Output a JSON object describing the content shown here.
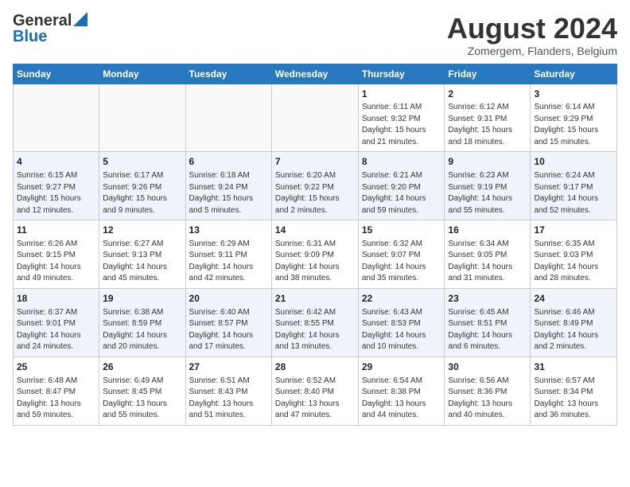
{
  "header": {
    "logo_general": "General",
    "logo_blue": "Blue",
    "month_title": "August 2024",
    "location": "Zomergem, Flanders, Belgium"
  },
  "weekdays": [
    "Sunday",
    "Monday",
    "Tuesday",
    "Wednesday",
    "Thursday",
    "Friday",
    "Saturday"
  ],
  "rows": [
    {
      "cells": [
        {
          "day": "",
          "empty": true
        },
        {
          "day": "",
          "empty": true
        },
        {
          "day": "",
          "empty": true
        },
        {
          "day": "",
          "empty": true
        },
        {
          "day": "1",
          "sunrise": "6:11 AM",
          "sunset": "9:32 PM",
          "daylight": "15 hours and 21 minutes."
        },
        {
          "day": "2",
          "sunrise": "6:12 AM",
          "sunset": "9:31 PM",
          "daylight": "15 hours and 18 minutes."
        },
        {
          "day": "3",
          "sunrise": "6:14 AM",
          "sunset": "9:29 PM",
          "daylight": "15 hours and 15 minutes."
        }
      ]
    },
    {
      "stripe": true,
      "cells": [
        {
          "day": "4",
          "sunrise": "6:15 AM",
          "sunset": "9:27 PM",
          "daylight": "15 hours and 12 minutes."
        },
        {
          "day": "5",
          "sunrise": "6:17 AM",
          "sunset": "9:26 PM",
          "daylight": "15 hours and 9 minutes."
        },
        {
          "day": "6",
          "sunrise": "6:18 AM",
          "sunset": "9:24 PM",
          "daylight": "15 hours and 5 minutes."
        },
        {
          "day": "7",
          "sunrise": "6:20 AM",
          "sunset": "9:22 PM",
          "daylight": "15 hours and 2 minutes."
        },
        {
          "day": "8",
          "sunrise": "6:21 AM",
          "sunset": "9:20 PM",
          "daylight": "14 hours and 59 minutes."
        },
        {
          "day": "9",
          "sunrise": "6:23 AM",
          "sunset": "9:19 PM",
          "daylight": "14 hours and 55 minutes."
        },
        {
          "day": "10",
          "sunrise": "6:24 AM",
          "sunset": "9:17 PM",
          "daylight": "14 hours and 52 minutes."
        }
      ]
    },
    {
      "cells": [
        {
          "day": "11",
          "sunrise": "6:26 AM",
          "sunset": "9:15 PM",
          "daylight": "14 hours and 49 minutes."
        },
        {
          "day": "12",
          "sunrise": "6:27 AM",
          "sunset": "9:13 PM",
          "daylight": "14 hours and 45 minutes."
        },
        {
          "day": "13",
          "sunrise": "6:29 AM",
          "sunset": "9:11 PM",
          "daylight": "14 hours and 42 minutes."
        },
        {
          "day": "14",
          "sunrise": "6:31 AM",
          "sunset": "9:09 PM",
          "daylight": "14 hours and 38 minutes."
        },
        {
          "day": "15",
          "sunrise": "6:32 AM",
          "sunset": "9:07 PM",
          "daylight": "14 hours and 35 minutes."
        },
        {
          "day": "16",
          "sunrise": "6:34 AM",
          "sunset": "9:05 PM",
          "daylight": "14 hours and 31 minutes."
        },
        {
          "day": "17",
          "sunrise": "6:35 AM",
          "sunset": "9:03 PM",
          "daylight": "14 hours and 28 minutes."
        }
      ]
    },
    {
      "stripe": true,
      "cells": [
        {
          "day": "18",
          "sunrise": "6:37 AM",
          "sunset": "9:01 PM",
          "daylight": "14 hours and 24 minutes."
        },
        {
          "day": "19",
          "sunrise": "6:38 AM",
          "sunset": "8:59 PM",
          "daylight": "14 hours and 20 minutes."
        },
        {
          "day": "20",
          "sunrise": "6:40 AM",
          "sunset": "8:57 PM",
          "daylight": "14 hours and 17 minutes."
        },
        {
          "day": "21",
          "sunrise": "6:42 AM",
          "sunset": "8:55 PM",
          "daylight": "14 hours and 13 minutes."
        },
        {
          "day": "22",
          "sunrise": "6:43 AM",
          "sunset": "8:53 PM",
          "daylight": "14 hours and 10 minutes."
        },
        {
          "day": "23",
          "sunrise": "6:45 AM",
          "sunset": "8:51 PM",
          "daylight": "14 hours and 6 minutes."
        },
        {
          "day": "24",
          "sunrise": "6:46 AM",
          "sunset": "8:49 PM",
          "daylight": "14 hours and 2 minutes."
        }
      ]
    },
    {
      "cells": [
        {
          "day": "25",
          "sunrise": "6:48 AM",
          "sunset": "8:47 PM",
          "daylight": "13 hours and 59 minutes."
        },
        {
          "day": "26",
          "sunrise": "6:49 AM",
          "sunset": "8:45 PM",
          "daylight": "13 hours and 55 minutes."
        },
        {
          "day": "27",
          "sunrise": "6:51 AM",
          "sunset": "8:43 PM",
          "daylight": "13 hours and 51 minutes."
        },
        {
          "day": "28",
          "sunrise": "6:52 AM",
          "sunset": "8:40 PM",
          "daylight": "13 hours and 47 minutes."
        },
        {
          "day": "29",
          "sunrise": "6:54 AM",
          "sunset": "8:38 PM",
          "daylight": "13 hours and 44 minutes."
        },
        {
          "day": "30",
          "sunrise": "6:56 AM",
          "sunset": "8:36 PM",
          "daylight": "13 hours and 40 minutes."
        },
        {
          "day": "31",
          "sunrise": "6:57 AM",
          "sunset": "8:34 PM",
          "daylight": "13 hours and 36 minutes."
        }
      ]
    }
  ],
  "labels": {
    "sunrise_prefix": "Sunrise: ",
    "sunset_prefix": "Sunset: ",
    "daylight_prefix": "Daylight: "
  }
}
